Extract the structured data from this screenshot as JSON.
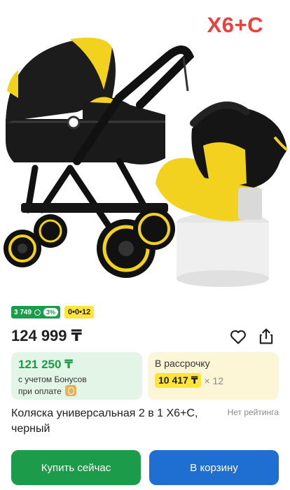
{
  "product_image": {
    "label": "X6+C",
    "label_color": "#e8423f",
    "alt": "stroller-with-car-seat-image"
  },
  "badges": {
    "bonus_amount": "3 749",
    "bonus_percent": "3%",
    "installment": "0•0•12"
  },
  "price": {
    "current": "124 999 ₸"
  },
  "bonus_card": {
    "amount": "121 250 ₸",
    "line1": "с учетом Бонусов",
    "line2": "при оплате"
  },
  "installment_card": {
    "title": "В рассрочку",
    "monthly": "10 417 ₸",
    "months": "× 12"
  },
  "product": {
    "title": "Коляска универсальная 2 в 1 X6+C, черный",
    "rating": "Нет рейтинга"
  },
  "actions": {
    "buy_now": "Купить сейчас",
    "add_to_cart": "В корзину"
  },
  "colors": {
    "green": "#1c9b4a",
    "blue": "#1f6fd2",
    "yellow": "#ffe43a"
  }
}
